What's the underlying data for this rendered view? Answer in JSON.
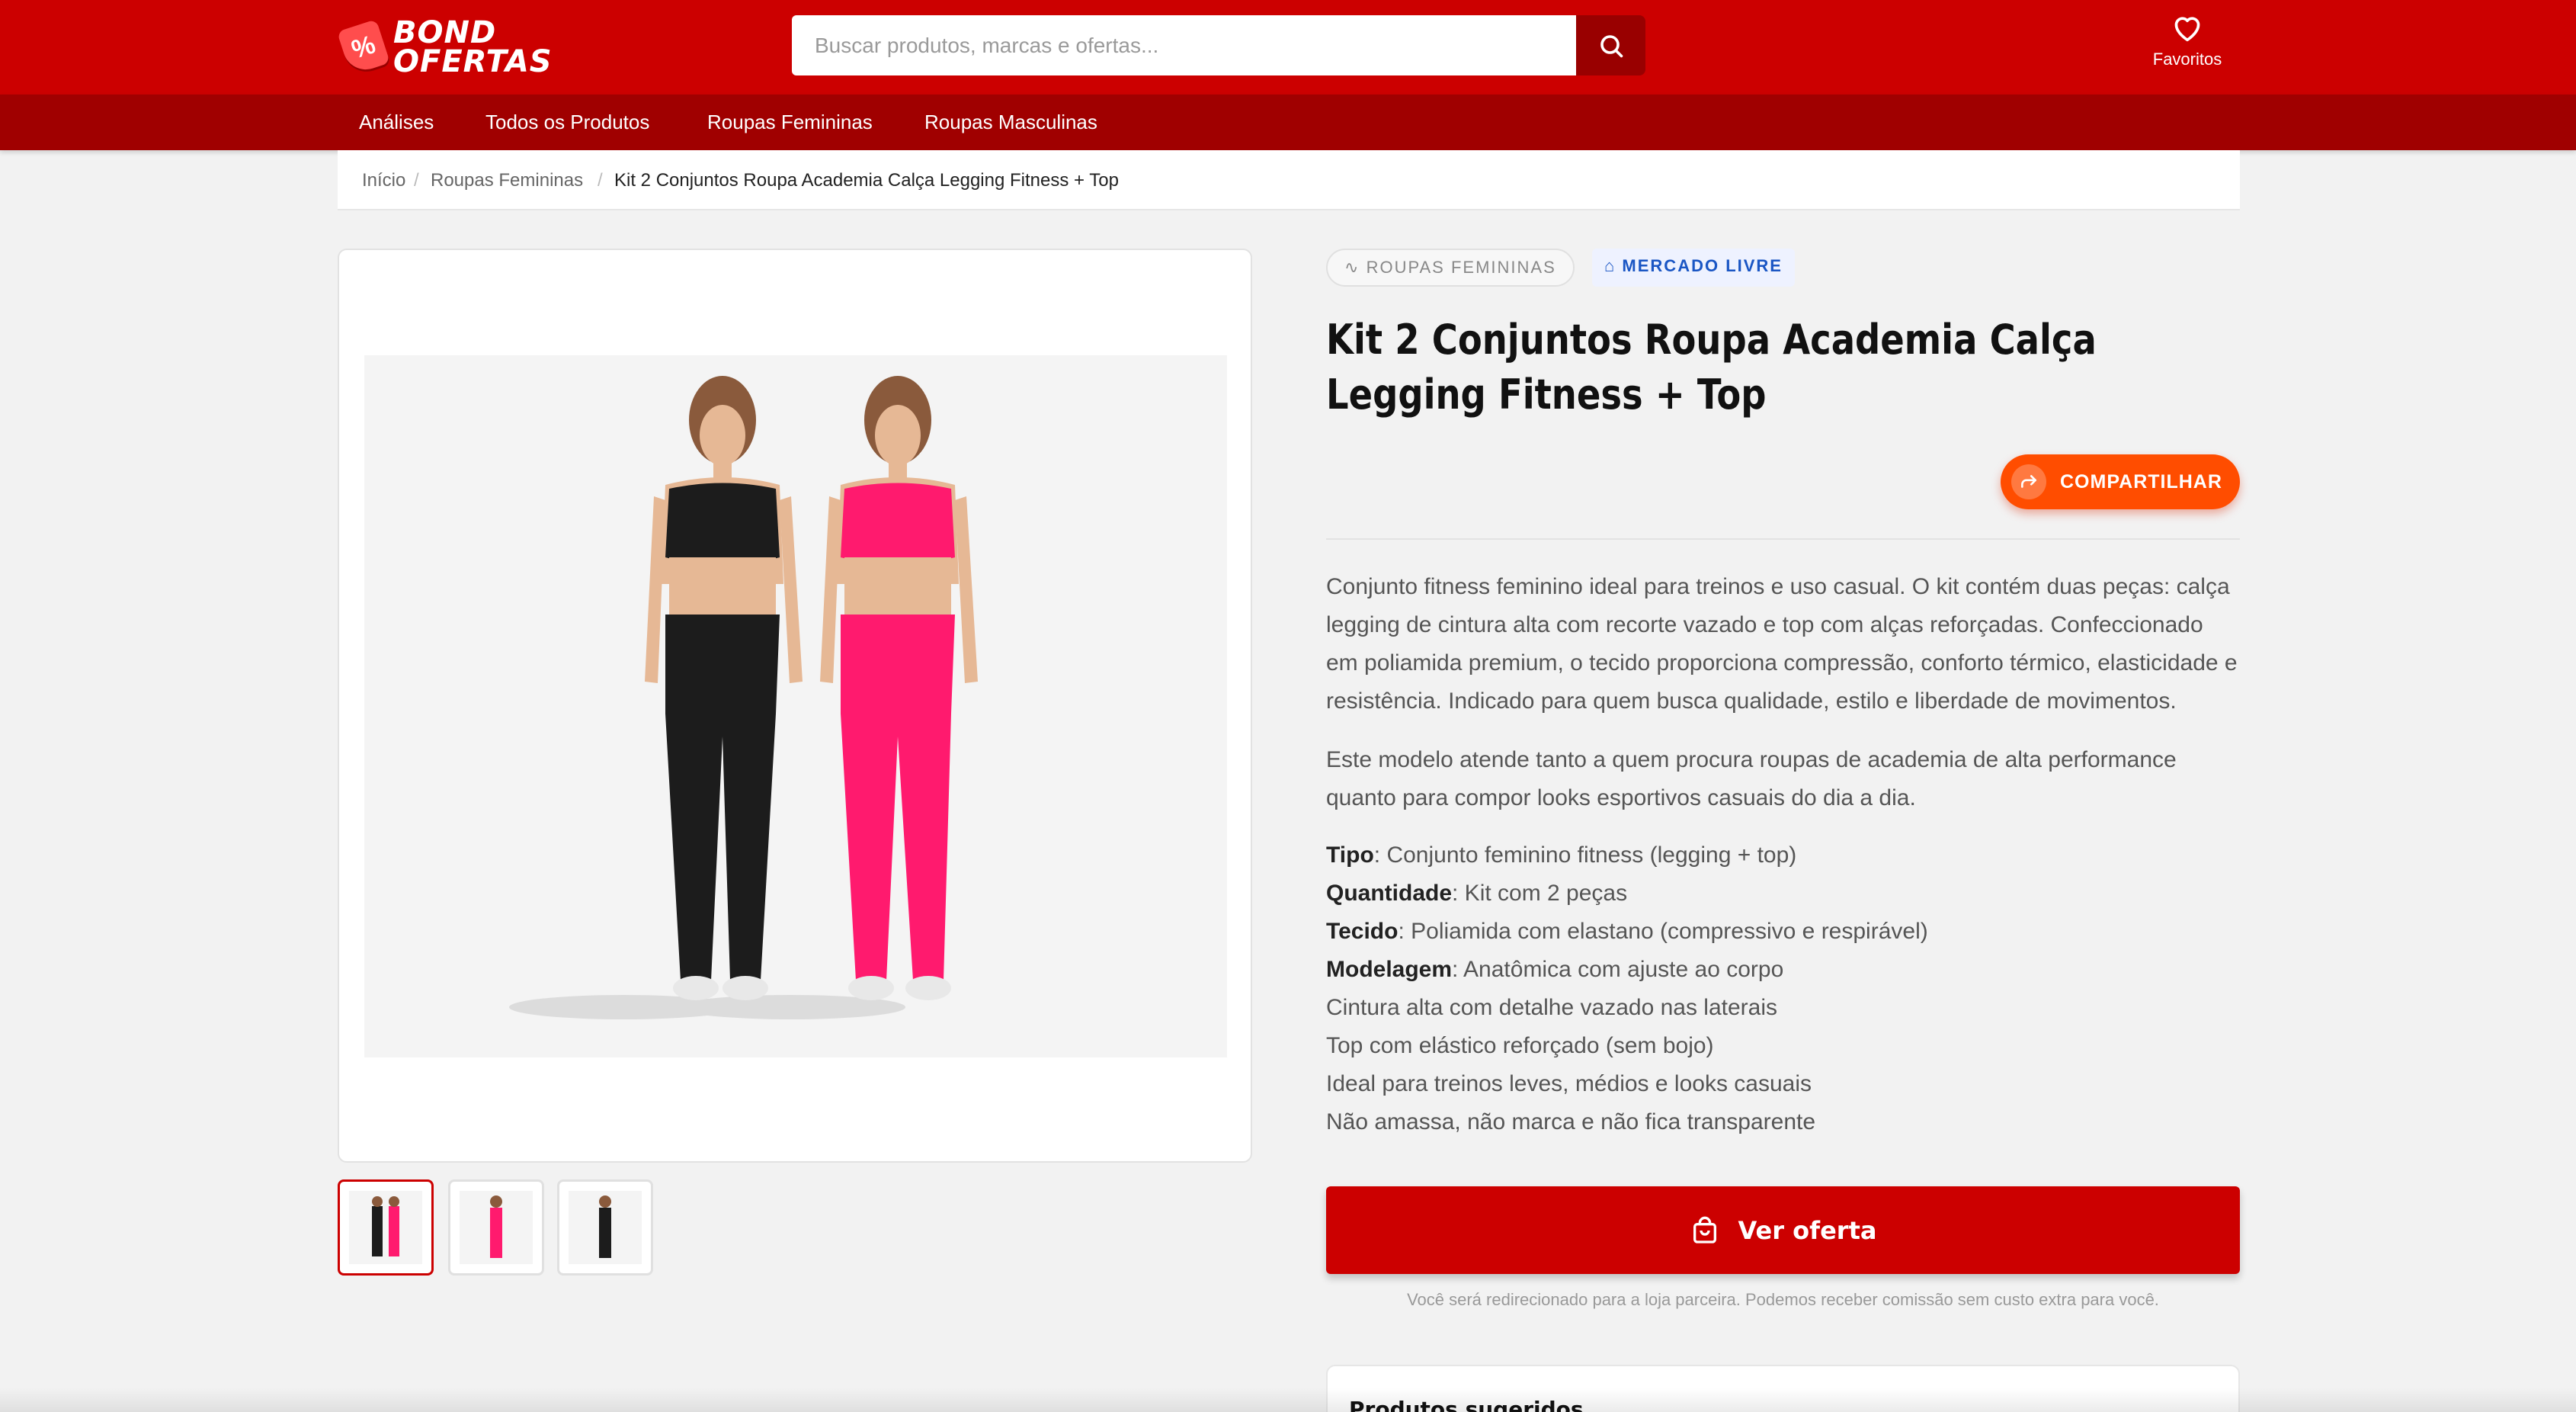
{
  "header": {
    "logo_line1": "BOND",
    "logo_line2": "OFERTAS",
    "logo_symbol": "%",
    "search_placeholder": "Buscar produtos, marcas e ofertas...",
    "favorites_label": "Favoritos"
  },
  "nav": {
    "items": [
      "Análises",
      "Todos os Produtos",
      "Roupas Femininas",
      "Roupas Masculinas"
    ]
  },
  "breadcrumb": {
    "items": [
      "Início",
      "Roupas Femininas",
      "Kit 2 Conjuntos Roupa Academia Calça Legging Fitness + Top"
    ],
    "separator": "/"
  },
  "product": {
    "category_badge": "ROUPAS FEMININAS",
    "store_badge": "MERCADO LIVRE",
    "title": "Kit 2 Conjuntos Roupa Academia Calça Legging Fitness + Top",
    "share_label": "COMPARTILHAR",
    "description": [
      "Conjunto fitness feminino ideal para treinos e uso casual. O kit contém duas peças: calça legging de cintura alta com recorte vazado e top com alças reforçadas. Confeccionado em poliamida premium, o tecido proporciona compressão, conforto térmico, elasticidade e resistência. Indicado para quem busca qualidade, estilo e liberdade de movimentos.",
      "Este modelo atende tanto a quem procura roupas de academia de alta performance quanto para compor looks esportivos casuais do dia a dia."
    ],
    "specs": [
      {
        "label": "Tipo",
        "value": ": Conjunto feminino fitness (legging + top)"
      },
      {
        "label": "Quantidade",
        "value": ": Kit com 2 peças"
      },
      {
        "label": "Tecido",
        "value": ": Poliamida com elastano (compressivo e respirável)"
      },
      {
        "label": "Modelagem",
        "value": ": Anatômica com ajuste ao corpo"
      }
    ],
    "features": [
      "Cintura alta com detalhe vazado nas laterais",
      "Top com elástico reforçado (sem bojo)",
      "Ideal para treinos leves, médios e looks casuais",
      "Não amassa, não marca e não fica transparente"
    ],
    "cta_label": "Ver oferta",
    "disclaimer": "Você será redirecionado para a loja parceira. Podemos receber comissão sem custo extra para você.",
    "suggested_title": "Produtos sugeridos"
  },
  "colors": {
    "brand_red": "#cc0000",
    "nav_red": "#a00000",
    "share_orange": "#ff4d00",
    "store_blue": "#1a56c4",
    "legging_black": "#1c1c1c",
    "legging_pink": "#ff1a6e"
  },
  "icons": [
    "search-icon",
    "heart-icon",
    "activity-icon",
    "store-icon",
    "share-icon",
    "shopping-bag-icon"
  ]
}
